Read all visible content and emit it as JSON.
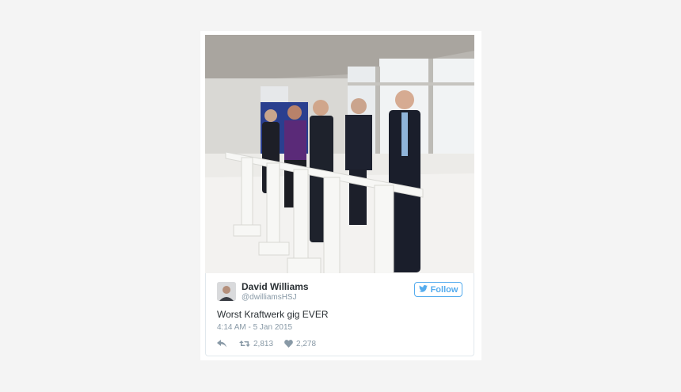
{
  "tweet": {
    "author_name": "David Williams",
    "author_handle": "@dwilliamsHSJ",
    "follow_label": "Follow",
    "text": "Worst Kraftwerk gig EVER",
    "timestamp": "4:14 AM - 5 Jan 2015",
    "retweet_count": "2,813",
    "like_count": "2,278"
  },
  "icons": {
    "reply": "reply-icon",
    "retweet": "retweet-icon",
    "like": "heart-icon",
    "follow": "twitter-bird-icon"
  },
  "colors": {
    "twitter_blue": "#55acee",
    "text_dark": "#292f33",
    "text_muted": "#8899a6",
    "border": "#e1e8ed",
    "page_bg": "#f4f4f4"
  }
}
